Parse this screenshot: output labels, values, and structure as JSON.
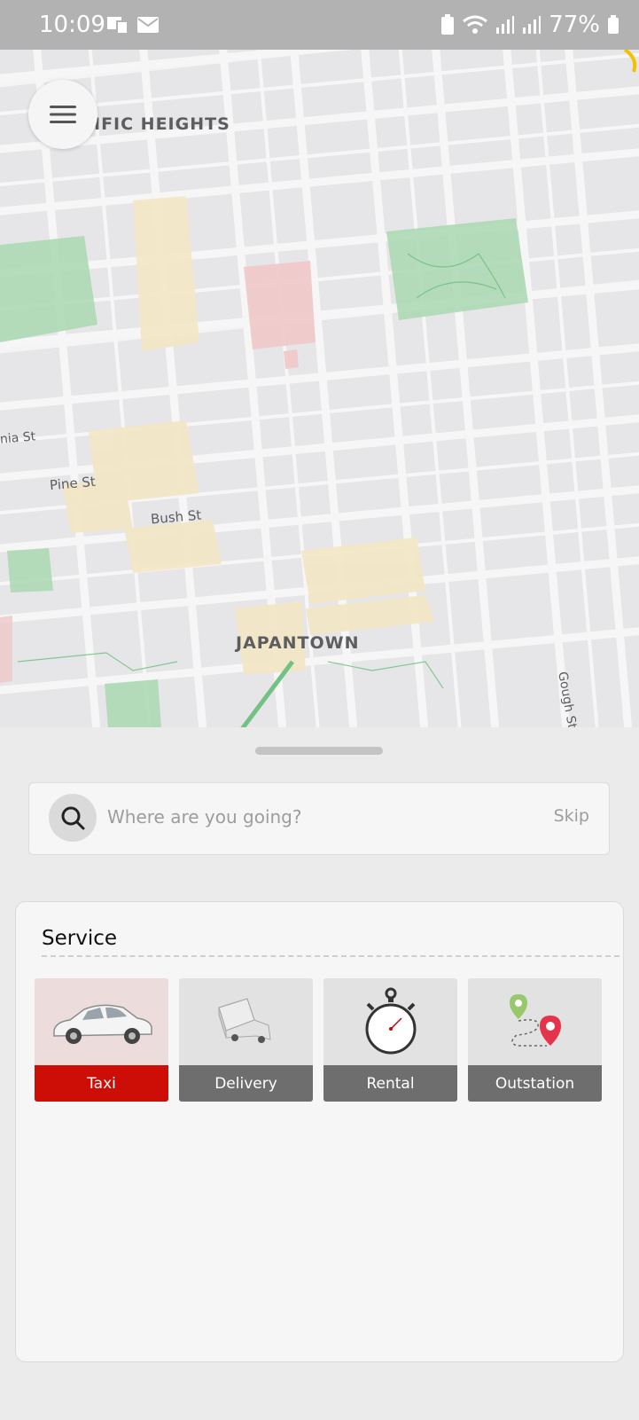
{
  "status_bar": {
    "time": "10:09",
    "battery": "77%"
  },
  "map": {
    "labels": {
      "heights": "IFIC HEIGHTS",
      "nia": "nia St",
      "pine": "Pine St",
      "bush": "Bush St",
      "japantown": "JAPANTOWN",
      "gough": "Gough St"
    }
  },
  "menu": {
    "icon": "hamburger-menu-icon"
  },
  "search": {
    "placeholder": "Where are you going?",
    "skip_label": "Skip",
    "icon": "search-icon"
  },
  "service": {
    "title": "Service",
    "items": [
      {
        "label": "Taxi",
        "icon": "car-icon",
        "selected": true
      },
      {
        "label": "Delivery",
        "icon": "truck-icon",
        "selected": false
      },
      {
        "label": "Rental",
        "icon": "stopwatch-icon",
        "selected": false
      },
      {
        "label": "Outstation",
        "icon": "route-pins-icon",
        "selected": false
      }
    ]
  },
  "colors": {
    "accent": "#cc0e07",
    "tile_label": "#6e6e6e",
    "park": "#a9d8b0",
    "commercial": "#f3e7c8"
  }
}
